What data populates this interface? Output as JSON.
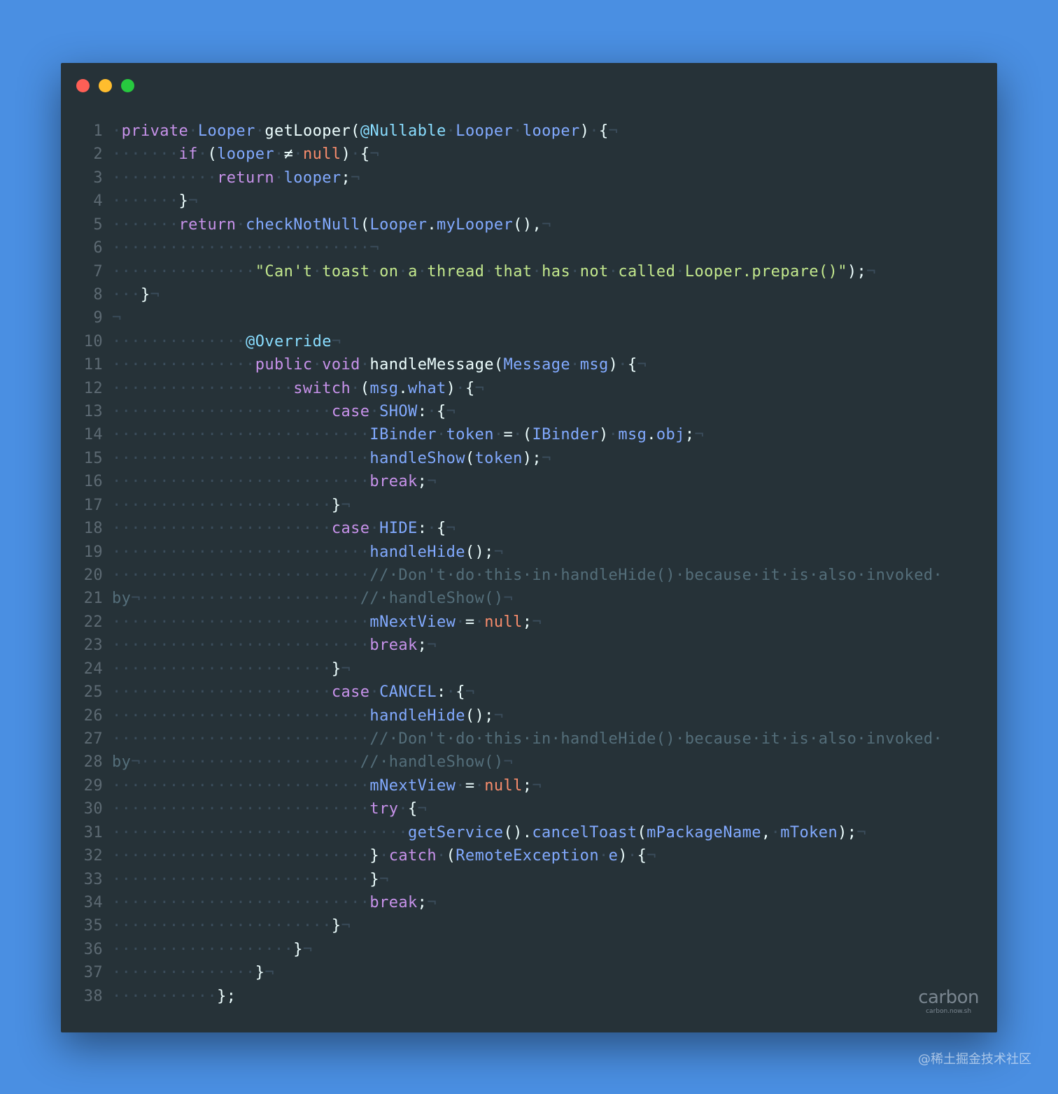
{
  "window": {
    "traffic_lights": [
      "close",
      "minimize",
      "maximize"
    ],
    "colors": {
      "background": "#263238",
      "page": "#4a8fe2"
    }
  },
  "code_lines": [
    {
      "n": "1",
      "tokens": [
        [
          "ws",
          "·"
        ],
        [
          "kw",
          "private"
        ],
        [
          "ws",
          "·"
        ],
        [
          "ty",
          "Looper"
        ],
        [
          "ws",
          "·"
        ],
        [
          "pl",
          "getLooper("
        ],
        [
          "an",
          "@Nullable"
        ],
        [
          "ws",
          "·"
        ],
        [
          "ty",
          "Looper"
        ],
        [
          "ws",
          "·"
        ],
        [
          "ty",
          "looper"
        ],
        [
          "pl",
          ")"
        ],
        [
          "ws",
          "·"
        ],
        [
          "pl",
          "{"
        ],
        [
          "ws",
          "¬"
        ]
      ]
    },
    {
      "n": "2",
      "tokens": [
        [
          "ws",
          "·······"
        ],
        [
          "kw",
          "if"
        ],
        [
          "ws",
          "·"
        ],
        [
          "pl",
          "("
        ],
        [
          "ty",
          "looper"
        ],
        [
          "ws",
          "·"
        ],
        [
          "pl",
          "≠"
        ],
        [
          "ws",
          "·"
        ],
        [
          "nu",
          "null"
        ],
        [
          "pl",
          ")"
        ],
        [
          "ws",
          "·"
        ],
        [
          "pl",
          "{"
        ],
        [
          "ws",
          "¬"
        ]
      ]
    },
    {
      "n": "3",
      "tokens": [
        [
          "ws",
          "···········"
        ],
        [
          "kw",
          "return"
        ],
        [
          "ws",
          "·"
        ],
        [
          "ty",
          "looper"
        ],
        [
          "pl",
          ";"
        ],
        [
          "ws",
          "¬"
        ]
      ]
    },
    {
      "n": "4",
      "tokens": [
        [
          "ws",
          "·······"
        ],
        [
          "pl",
          "}"
        ],
        [
          "ws",
          "¬"
        ]
      ]
    },
    {
      "n": "5",
      "tokens": [
        [
          "ws",
          "·······"
        ],
        [
          "kw",
          "return"
        ],
        [
          "ws",
          "·"
        ],
        [
          "fn",
          "checkNotNull"
        ],
        [
          "pl",
          "("
        ],
        [
          "ty",
          "Looper"
        ],
        [
          "pl",
          "."
        ],
        [
          "fn",
          "myLooper"
        ],
        [
          "pl",
          "(),"
        ],
        [
          "ws",
          "¬"
        ]
      ]
    },
    {
      "n": "6",
      "tokens": [
        [
          "ws",
          "···························¬"
        ]
      ]
    },
    {
      "n": "7",
      "tokens": [
        [
          "ws",
          "···············"
        ],
        [
          "st",
          "\"Can't"
        ],
        [
          "ws",
          "·"
        ],
        [
          "st",
          "toast"
        ],
        [
          "ws",
          "·"
        ],
        [
          "st",
          "on"
        ],
        [
          "ws",
          "·"
        ],
        [
          "st",
          "a"
        ],
        [
          "ws",
          "·"
        ],
        [
          "st",
          "thread"
        ],
        [
          "ws",
          "·"
        ],
        [
          "st",
          "that"
        ],
        [
          "ws",
          "·"
        ],
        [
          "st",
          "has"
        ],
        [
          "ws",
          "·"
        ],
        [
          "st",
          "not"
        ],
        [
          "ws",
          "·"
        ],
        [
          "st",
          "called"
        ],
        [
          "ws",
          "·"
        ],
        [
          "st",
          "Looper.prepare()\""
        ],
        [
          "pl",
          ");"
        ],
        [
          "ws",
          "¬"
        ]
      ]
    },
    {
      "n": "8",
      "tokens": [
        [
          "ws",
          "···"
        ],
        [
          "pl",
          "}"
        ],
        [
          "ws",
          "¬"
        ]
      ]
    },
    {
      "n": "9",
      "tokens": [
        [
          "ws",
          "¬"
        ]
      ]
    },
    {
      "n": "10",
      "tokens": [
        [
          "ws",
          "··············"
        ],
        [
          "an",
          "@Override"
        ],
        [
          "ws",
          "¬"
        ]
      ]
    },
    {
      "n": "11",
      "tokens": [
        [
          "ws",
          "···············"
        ],
        [
          "kw",
          "public"
        ],
        [
          "ws",
          "·"
        ],
        [
          "kw",
          "void"
        ],
        [
          "ws",
          "·"
        ],
        [
          "pl",
          "handleMessage("
        ],
        [
          "ty",
          "Message"
        ],
        [
          "ws",
          "·"
        ],
        [
          "ty",
          "msg"
        ],
        [
          "pl",
          ")"
        ],
        [
          "ws",
          "·"
        ],
        [
          "pl",
          "{"
        ],
        [
          "ws",
          "¬"
        ]
      ]
    },
    {
      "n": "12",
      "tokens": [
        [
          "ws",
          "···················"
        ],
        [
          "kw",
          "switch"
        ],
        [
          "ws",
          "·"
        ],
        [
          "pl",
          "("
        ],
        [
          "ty",
          "msg"
        ],
        [
          "pl",
          "."
        ],
        [
          "ty",
          "what"
        ],
        [
          "pl",
          ")"
        ],
        [
          "ws",
          "·"
        ],
        [
          "pl",
          "{"
        ],
        [
          "ws",
          "¬"
        ]
      ]
    },
    {
      "n": "13",
      "tokens": [
        [
          "ws",
          "·······················"
        ],
        [
          "kw",
          "case"
        ],
        [
          "ws",
          "·"
        ],
        [
          "ty",
          "SHOW"
        ],
        [
          "pl",
          ":"
        ],
        [
          "ws",
          "·"
        ],
        [
          "pl",
          "{"
        ],
        [
          "ws",
          "¬"
        ]
      ]
    },
    {
      "n": "14",
      "tokens": [
        [
          "ws",
          "···························"
        ],
        [
          "ty",
          "IBinder"
        ],
        [
          "ws",
          "·"
        ],
        [
          "ty",
          "token"
        ],
        [
          "ws",
          "·"
        ],
        [
          "pl",
          "="
        ],
        [
          "ws",
          "·"
        ],
        [
          "pl",
          "("
        ],
        [
          "ty",
          "IBinder"
        ],
        [
          "pl",
          ")"
        ],
        [
          "ws",
          "·"
        ],
        [
          "ty",
          "msg"
        ],
        [
          "pl",
          "."
        ],
        [
          "ty",
          "obj"
        ],
        [
          "pl",
          ";"
        ],
        [
          "ws",
          "¬"
        ]
      ]
    },
    {
      "n": "15",
      "tokens": [
        [
          "ws",
          "···························"
        ],
        [
          "fn",
          "handleShow"
        ],
        [
          "pl",
          "("
        ],
        [
          "ty",
          "token"
        ],
        [
          "pl",
          ");"
        ],
        [
          "ws",
          "¬"
        ]
      ]
    },
    {
      "n": "16",
      "tokens": [
        [
          "ws",
          "···························"
        ],
        [
          "kw",
          "break"
        ],
        [
          "pl",
          ";"
        ],
        [
          "ws",
          "¬"
        ]
      ]
    },
    {
      "n": "17",
      "tokens": [
        [
          "ws",
          "·······················"
        ],
        [
          "pl",
          "}"
        ],
        [
          "ws",
          "¬"
        ]
      ]
    },
    {
      "n": "18",
      "tokens": [
        [
          "ws",
          "·······················"
        ],
        [
          "kw",
          "case"
        ],
        [
          "ws",
          "·"
        ],
        [
          "ty",
          "HIDE"
        ],
        [
          "pl",
          ":"
        ],
        [
          "ws",
          "·"
        ],
        [
          "pl",
          "{"
        ],
        [
          "ws",
          "¬"
        ]
      ]
    },
    {
      "n": "19",
      "tokens": [
        [
          "ws",
          "···························"
        ],
        [
          "fn",
          "handleHide"
        ],
        [
          "pl",
          "();"
        ],
        [
          "ws",
          "¬"
        ]
      ]
    },
    {
      "n": "20",
      "tokens": [
        [
          "ws",
          "···························"
        ],
        [
          "cm",
          "//·Don't·do·this·in·handleHide()·because·it·is·also·invoked·"
        ]
      ]
    },
    {
      "n": "21",
      "tokens": [
        [
          "cm",
          "by"
        ],
        [
          "ws",
          "¬·······················"
        ],
        [
          "cm",
          "//·handleShow()"
        ],
        [
          "ws",
          "¬"
        ]
      ]
    },
    {
      "n": "22",
      "tokens": [
        [
          "ws",
          "···························"
        ],
        [
          "ty",
          "mNextView"
        ],
        [
          "ws",
          "·"
        ],
        [
          "pl",
          "="
        ],
        [
          "ws",
          "·"
        ],
        [
          "nu",
          "null"
        ],
        [
          "pl",
          ";"
        ],
        [
          "ws",
          "¬"
        ]
      ]
    },
    {
      "n": "23",
      "tokens": [
        [
          "ws",
          "···························"
        ],
        [
          "kw",
          "break"
        ],
        [
          "pl",
          ";"
        ],
        [
          "ws",
          "¬"
        ]
      ]
    },
    {
      "n": "24",
      "tokens": [
        [
          "ws",
          "·······················"
        ],
        [
          "pl",
          "}"
        ],
        [
          "ws",
          "¬"
        ]
      ]
    },
    {
      "n": "25",
      "tokens": [
        [
          "ws",
          "·······················"
        ],
        [
          "kw",
          "case"
        ],
        [
          "ws",
          "·"
        ],
        [
          "ty",
          "CANCEL"
        ],
        [
          "pl",
          ":"
        ],
        [
          "ws",
          "·"
        ],
        [
          "pl",
          "{"
        ],
        [
          "ws",
          "¬"
        ]
      ]
    },
    {
      "n": "26",
      "tokens": [
        [
          "ws",
          "···························"
        ],
        [
          "fn",
          "handleHide"
        ],
        [
          "pl",
          "();"
        ],
        [
          "ws",
          "¬"
        ]
      ]
    },
    {
      "n": "27",
      "tokens": [
        [
          "ws",
          "···························"
        ],
        [
          "cm",
          "//·Don't·do·this·in·handleHide()·because·it·is·also·invoked·"
        ]
      ]
    },
    {
      "n": "28",
      "tokens": [
        [
          "cm",
          "by"
        ],
        [
          "ws",
          "¬·······················"
        ],
        [
          "cm",
          "//·handleShow()"
        ],
        [
          "ws",
          "¬"
        ]
      ]
    },
    {
      "n": "29",
      "tokens": [
        [
          "ws",
          "···························"
        ],
        [
          "ty",
          "mNextView"
        ],
        [
          "ws",
          "·"
        ],
        [
          "pl",
          "="
        ],
        [
          "ws",
          "·"
        ],
        [
          "nu",
          "null"
        ],
        [
          "pl",
          ";"
        ],
        [
          "ws",
          "¬"
        ]
      ]
    },
    {
      "n": "30",
      "tokens": [
        [
          "ws",
          "···························"
        ],
        [
          "kw",
          "try"
        ],
        [
          "ws",
          "·"
        ],
        [
          "pl",
          "{"
        ],
        [
          "ws",
          "¬"
        ]
      ]
    },
    {
      "n": "31",
      "tokens": [
        [
          "ws",
          "·······························"
        ],
        [
          "fn",
          "getService"
        ],
        [
          "pl",
          "()."
        ],
        [
          "fn",
          "cancelToast"
        ],
        [
          "pl",
          "("
        ],
        [
          "ty",
          "mPackageName"
        ],
        [
          "pl",
          ","
        ],
        [
          "ws",
          "·"
        ],
        [
          "ty",
          "mToken"
        ],
        [
          "pl",
          ");"
        ],
        [
          "ws",
          "¬"
        ]
      ]
    },
    {
      "n": "32",
      "tokens": [
        [
          "ws",
          "···························"
        ],
        [
          "pl",
          "}"
        ],
        [
          "ws",
          "·"
        ],
        [
          "kw",
          "catch"
        ],
        [
          "ws",
          "·"
        ],
        [
          "pl",
          "("
        ],
        [
          "ty",
          "RemoteException"
        ],
        [
          "ws",
          "·"
        ],
        [
          "ty",
          "e"
        ],
        [
          "pl",
          ")"
        ],
        [
          "ws",
          "·"
        ],
        [
          "pl",
          "{"
        ],
        [
          "ws",
          "¬"
        ]
      ]
    },
    {
      "n": "33",
      "tokens": [
        [
          "ws",
          "···························"
        ],
        [
          "pl",
          "}"
        ],
        [
          "ws",
          "¬"
        ]
      ]
    },
    {
      "n": "34",
      "tokens": [
        [
          "ws",
          "···························"
        ],
        [
          "kw",
          "break"
        ],
        [
          "pl",
          ";"
        ],
        [
          "ws",
          "¬"
        ]
      ]
    },
    {
      "n": "35",
      "tokens": [
        [
          "ws",
          "·······················"
        ],
        [
          "pl",
          "}"
        ],
        [
          "ws",
          "¬"
        ]
      ]
    },
    {
      "n": "36",
      "tokens": [
        [
          "ws",
          "···················"
        ],
        [
          "pl",
          "}"
        ],
        [
          "ws",
          "¬"
        ]
      ]
    },
    {
      "n": "37",
      "tokens": [
        [
          "ws",
          "···············"
        ],
        [
          "pl",
          "}"
        ],
        [
          "ws",
          "¬"
        ]
      ]
    },
    {
      "n": "38",
      "tokens": [
        [
          "ws",
          "···········"
        ],
        [
          "pl",
          "};"
        ]
      ]
    }
  ],
  "logo": {
    "name": "carbon",
    "url_text": "carbon.now.sh"
  },
  "watermark": "@稀土掘金技术社区"
}
